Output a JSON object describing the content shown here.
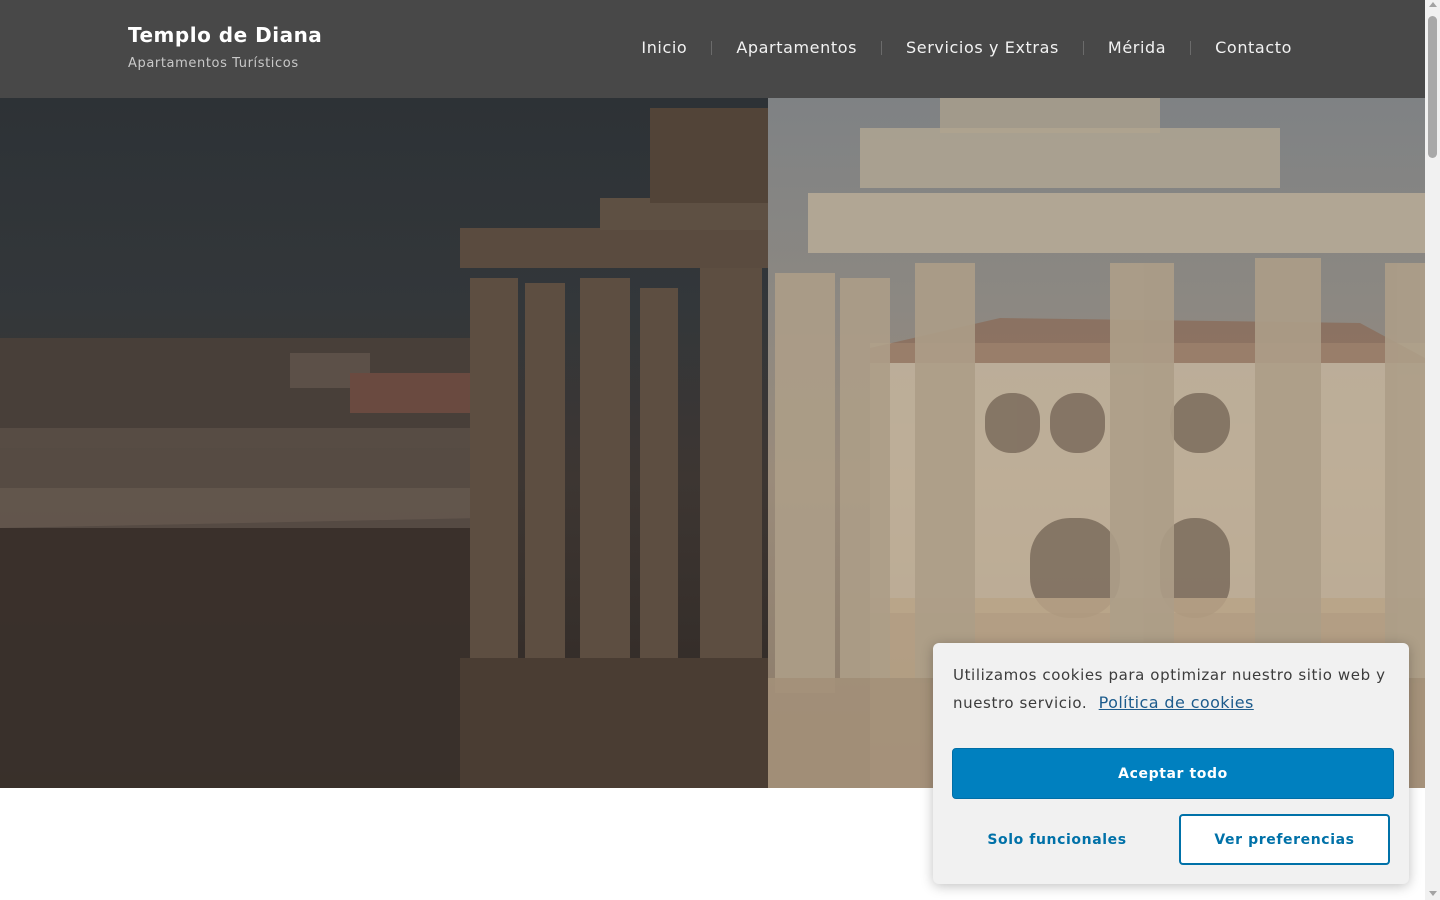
{
  "brand": {
    "title": "Templo de Diana",
    "subtitle": "Apartamentos Turísticos"
  },
  "nav": {
    "items": [
      {
        "label": "Inicio"
      },
      {
        "label": "Apartamentos"
      },
      {
        "label": "Servicios y Extras"
      },
      {
        "label": "Mérida"
      },
      {
        "label": "Contacto"
      }
    ]
  },
  "hero": {
    "image": "temple-of-diana-photo"
  },
  "cookie": {
    "message": "Utilizamos cookies para optimizar nuestro sitio web y nuestro servicio.",
    "policy_link": "Política de cookies",
    "accept_all": "Aceptar todo",
    "functional_only": "Solo funcionales",
    "preferences": "Ver preferencias"
  },
  "colors": {
    "header_bg": "#484848",
    "accent": "#0080bf",
    "cookie_bg": "#f1f1f1"
  }
}
